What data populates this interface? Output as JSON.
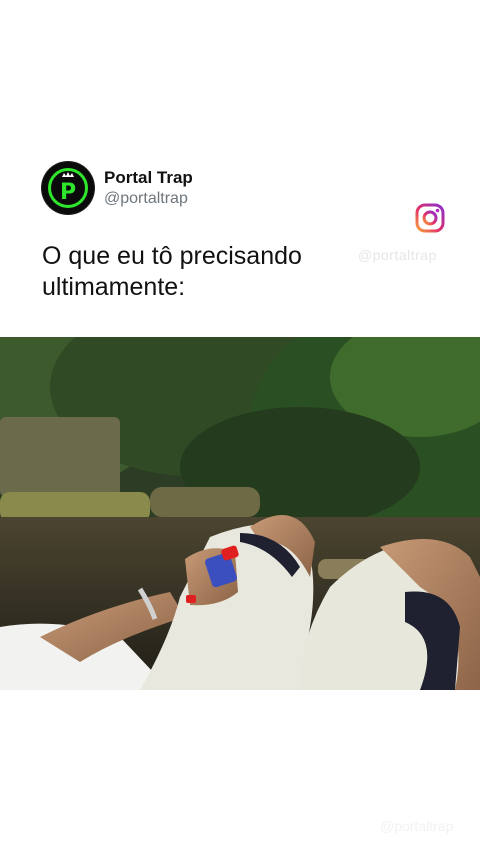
{
  "post": {
    "display_name": "Portal Trap",
    "handle": "@portaltrap",
    "text": "O que eu tô precisando ultimamente:"
  },
  "avatar": {
    "icon": "portal-trap-logo-icon",
    "letter": "P",
    "accent": "#2ee62b"
  },
  "instagram": {
    "icon": "instagram-icon"
  },
  "watermark": {
    "text": "@portaltrap"
  },
  "media": {
    "type": "video",
    "description_icon": "video-frame"
  },
  "colors": {
    "background": "#ffffff",
    "text": "#111111",
    "muted": "#6e767d",
    "brand_green": "#2ee62b"
  }
}
